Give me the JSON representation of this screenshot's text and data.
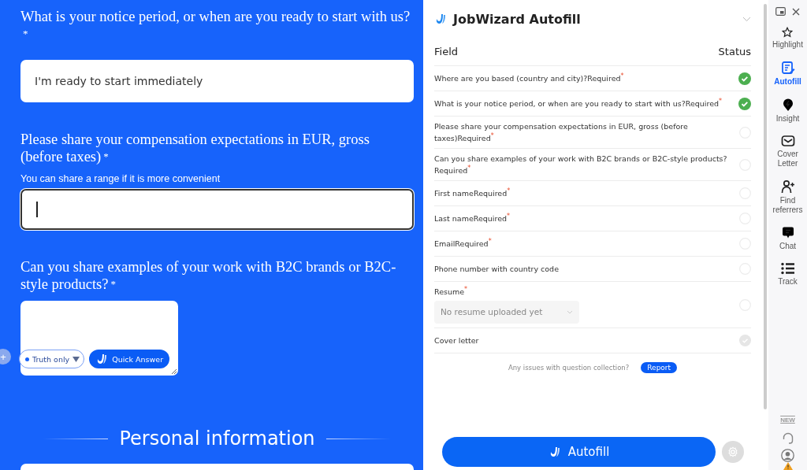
{
  "form": {
    "questions": [
      {
        "kind": "input",
        "title": "What is your notice period, or when are you ready to start with us?",
        "mark": "*",
        "value": "I'm ready to start immediately",
        "focused": false
      },
      {
        "kind": "input",
        "title": "Please share your compensation expectations in EUR, gross (before taxes)",
        "mark": "*",
        "hint": "You can share a range if it is more convenient",
        "focused": true
      },
      {
        "kind": "textarea",
        "title": "Can you share examples of your work with B2C brands or B2C-style products?",
        "mark": "*",
        "mode": "Truth only",
        "action": "Quick Answer"
      }
    ],
    "add_button": "+",
    "section_title": "Personal information"
  },
  "panel": {
    "title": "JobWizard Autofill",
    "columns": [
      "Field",
      "Status"
    ],
    "rows": [
      {
        "label": "Where are you based (country and city)?Required$^{*}$",
        "kind": "done"
      },
      {
        "label": "What is your notice period, or when are you ready to start with us?Required$^{*}$",
        "kind": "done"
      },
      {
        "label": "Please share your compensation expectations in EUR, gross (before taxes)Required$^{*}$",
        "kind": "pending"
      },
      {
        "label": "Can you share examples of your work with B2C brands or B2C-style products?Required$^{*}$",
        "kind": "pending"
      },
      {
        "label": "First nameRequired$^{*}$",
        "kind": "pending"
      },
      {
        "label": "Last nameRequired$^{*}$",
        "kind": "pending"
      },
      {
        "label": "EmailRequired$^{*}$",
        "kind": "pending"
      },
      {
        "label": "Phone number with country code",
        "kind": "pending"
      },
      {
        "label": "Resume$^{*}$",
        "select": "No resume uploaded yet",
        "kind": "pending"
      },
      {
        "label": "Cover letter",
        "kind": "skipped"
      }
    ],
    "report_text": "Any issues with question collection?",
    "report_button": "Report",
    "autofill_button": "Autofill"
  },
  "rail": {
    "items": [
      {
        "kind": "star",
        "label": "Highlight",
        "selected": false
      },
      {
        "kind": "form",
        "label": "Autofill",
        "selected": true
      },
      {
        "kind": "pin",
        "label": "Insight",
        "selected": false
      },
      {
        "kind": "mail",
        "label": "Cover Letter",
        "selected": false
      },
      {
        "kind": "person-add",
        "label": "Find referrers",
        "selected": false
      },
      {
        "kind": "chat",
        "label": "Chat",
        "selected": false
      },
      {
        "kind": "list",
        "label": "Track",
        "selected": false
      }
    ],
    "new_badge": "NEW"
  }
}
